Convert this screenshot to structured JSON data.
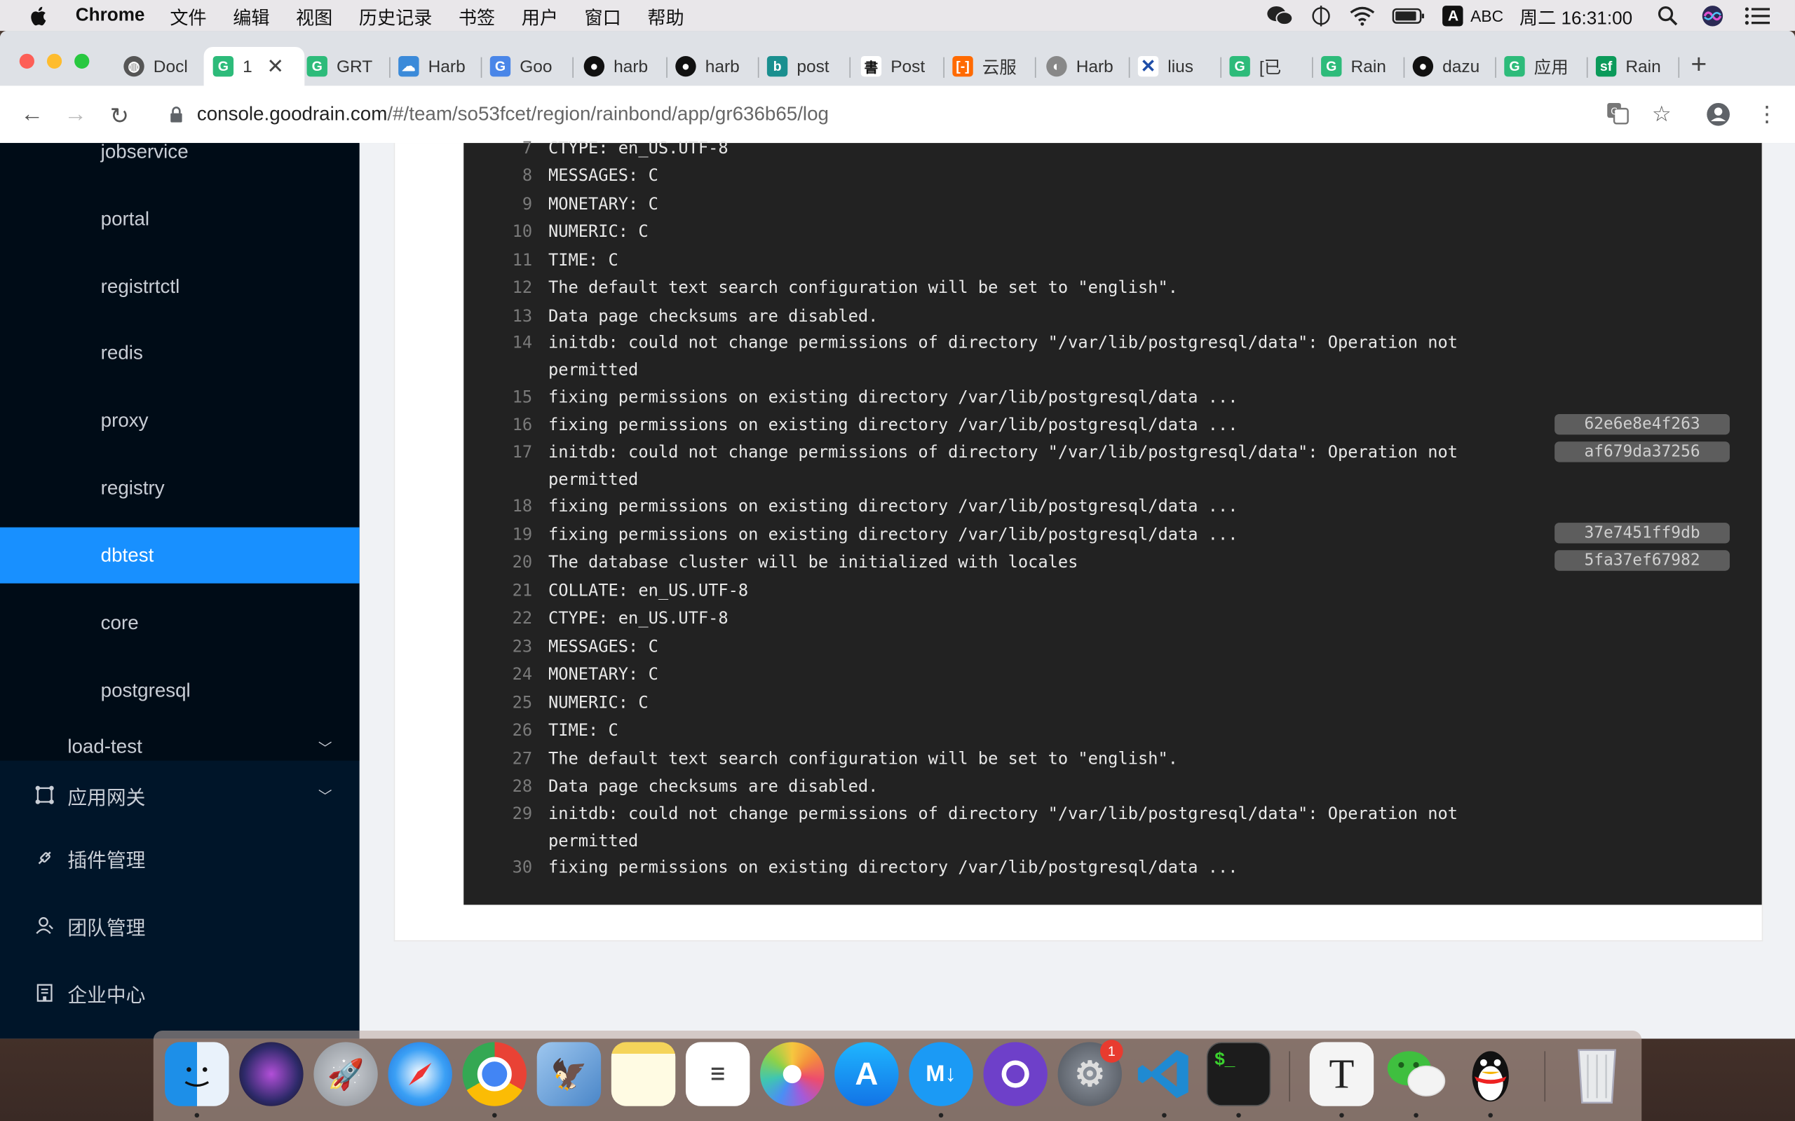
{
  "menubar": {
    "app": "Chrome",
    "items": [
      "文件",
      "编辑",
      "视图",
      "历史记录",
      "书签",
      "用户",
      "窗口",
      "帮助"
    ],
    "input_source": "ABC",
    "clock": "周二 16:31:00"
  },
  "tabs": [
    {
      "label": "Docl"
    },
    {
      "label": "1"
    },
    {
      "label": "GRT"
    },
    {
      "label": "Harb"
    },
    {
      "label": "Goo"
    },
    {
      "label": "harb"
    },
    {
      "label": "harb"
    },
    {
      "label": "post"
    },
    {
      "label": "Post"
    },
    {
      "label": "云服"
    },
    {
      "label": "Harb"
    },
    {
      "label": "lius"
    },
    {
      "label": "[已"
    },
    {
      "label": "Rain"
    },
    {
      "label": "dazu"
    },
    {
      "label": "应用"
    },
    {
      "label": "Rain"
    }
  ],
  "address": {
    "host": "console.goodrain.com",
    "path": "/#/team/so53fcet/region/rainbond/app/gr636b65/log"
  },
  "sidebar": {
    "items": [
      {
        "label": "jobservice"
      },
      {
        "label": "portal"
      },
      {
        "label": "registrtctl"
      },
      {
        "label": "redis"
      },
      {
        "label": "proxy"
      },
      {
        "label": "registry"
      },
      {
        "label": "dbtest"
      },
      {
        "label": "core"
      },
      {
        "label": "postgresql"
      }
    ],
    "partial_group": "load-test",
    "groups": [
      {
        "label": "应用网关"
      },
      {
        "label": "插件管理"
      },
      {
        "label": "团队管理"
      },
      {
        "label": "企业中心"
      }
    ]
  },
  "log": {
    "lines": [
      {
        "no": "7",
        "text": "CTYPE: en_US.UTF-8"
      },
      {
        "no": "8",
        "text": "MESSAGES: C"
      },
      {
        "no": "9",
        "text": "MONETARY: C"
      },
      {
        "no": "10",
        "text": "NUMERIC: C"
      },
      {
        "no": "11",
        "text": "TIME: C"
      },
      {
        "no": "12",
        "text": "The default text search configuration will be set to \"english\"."
      },
      {
        "no": "13",
        "text": "Data page checksums are disabled."
      },
      {
        "no": "14",
        "text": "initdb: could not change permissions of directory \"/var/lib/postgresql/data\": Operation not permitted"
      },
      {
        "no": "15",
        "text": "fixing permissions on existing directory /var/lib/postgresql/data ..."
      },
      {
        "no": "16",
        "text": "fixing permissions on existing directory /var/lib/postgresql/data ..."
      },
      {
        "no": "17",
        "text": "initdb: could not change permissions of directory \"/var/lib/postgresql/data\": Operation not permitted"
      },
      {
        "no": "18",
        "text": "fixing permissions on existing directory /var/lib/postgresql/data ..."
      },
      {
        "no": "19",
        "text": "fixing permissions on existing directory /var/lib/postgresql/data ..."
      },
      {
        "no": "20",
        "text": "The database cluster will be initialized with locales"
      },
      {
        "no": "21",
        "text": "COLLATE: en_US.UTF-8"
      },
      {
        "no": "22",
        "text": "CTYPE: en_US.UTF-8"
      },
      {
        "no": "23",
        "text": "MESSAGES: C"
      },
      {
        "no": "24",
        "text": "MONETARY: C"
      },
      {
        "no": "25",
        "text": "NUMERIC: C"
      },
      {
        "no": "26",
        "text": "TIME: C"
      },
      {
        "no": "27",
        "text": "The default text search configuration will be set to \"english\"."
      },
      {
        "no": "28",
        "text": "Data page checksums are disabled."
      },
      {
        "no": "29",
        "text": "initdb: could not change permissions of directory \"/var/lib/postgresql/data\": Operation not permitted"
      },
      {
        "no": "30",
        "text": "fixing permissions on existing directory /var/lib/postgresql/data ..."
      }
    ],
    "hashes": [
      {
        "text": "62e6e8e4f263"
      },
      {
        "text": "af679da37256"
      },
      {
        "text": "37e7451ff9db"
      },
      {
        "text": "5fa37ef67982"
      }
    ]
  },
  "dock": {
    "badge": "1"
  },
  "colors": {
    "sidebar_bg": "#001529",
    "selected": "#1890ff",
    "log_bg": "#222222"
  }
}
